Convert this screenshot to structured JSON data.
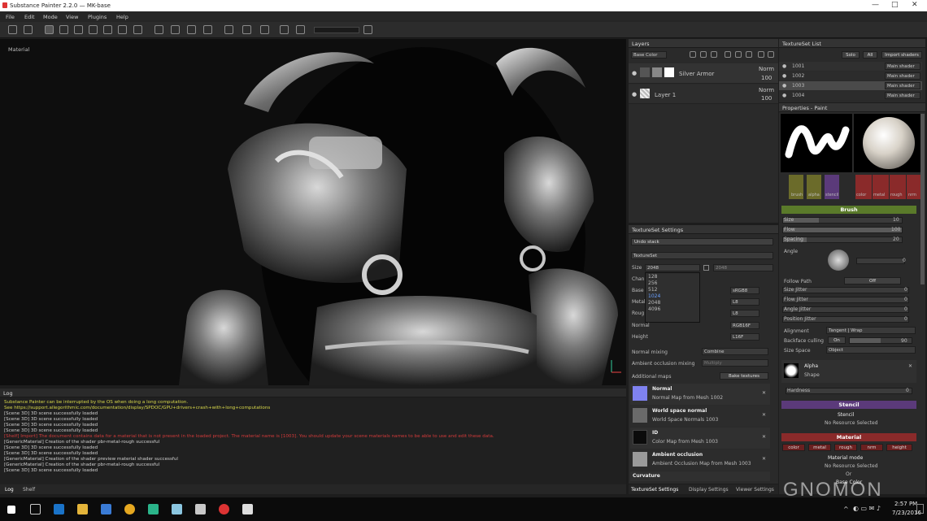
{
  "window": {
    "title": "Substance Painter 2.2.0 — MK-base",
    "controls": [
      "—",
      "□",
      "✕"
    ]
  },
  "menu": [
    "File",
    "Edit",
    "Mode",
    "View",
    "Plugins",
    "Help"
  ],
  "viewport": {
    "label": "Material"
  },
  "layers": {
    "title": "Layers",
    "channel": "Base Color",
    "items": [
      {
        "name": "Silver Armor",
        "blend": "Norm",
        "opacity": "100"
      },
      {
        "name": "Layer 1",
        "blend": "Norm",
        "opacity": "100"
      }
    ]
  },
  "textureset_list": {
    "title": "TextureSet List",
    "buttons": {
      "solo": "Solo",
      "all": "All",
      "import": "Import shaders"
    },
    "items": [
      {
        "name": "1001",
        "shader": "Main shader"
      },
      {
        "name": "1002",
        "shader": "Main shader"
      },
      {
        "name": "1003",
        "shader": "Main shader"
      },
      {
        "name": "1004",
        "shader": "Main shader"
      }
    ]
  },
  "properties": {
    "title": "Properties - Paint",
    "thumbs": [
      "brush",
      "alpha",
      "stencil"
    ],
    "mat_thumbs": [
      "color",
      "metal",
      "rough",
      "nrm"
    ],
    "brush_section": "Brush",
    "size": {
      "label": "Size",
      "value": "10"
    },
    "flow": {
      "label": "Flow",
      "value": "100"
    },
    "spacing": {
      "label": "Spacing",
      "value": "20"
    },
    "angle": {
      "label": "Angle",
      "value": "0"
    },
    "follow_path": {
      "label": "Follow Path",
      "value": "Off"
    },
    "jitters": [
      {
        "label": "Size Jitter",
        "value": "0"
      },
      {
        "label": "Flow Jitter",
        "value": "0"
      },
      {
        "label": "Angle Jitter",
        "value": "0"
      },
      {
        "label": "Position Jitter",
        "value": "0"
      }
    ],
    "alignment": {
      "label": "Alignment",
      "value": "Tangent | Wrap"
    },
    "backface": {
      "label": "Backface culling",
      "toggle": "On",
      "value": "90"
    },
    "size_space": {
      "label": "Size Space",
      "value": "Object"
    },
    "alpha": {
      "label": "Alpha",
      "value": "Shape"
    },
    "hardness": {
      "label": "Hardness",
      "value": "0"
    },
    "stencil_section": "Stencil",
    "stencil": {
      "label": "Stencil",
      "value": "No Resource Selected"
    },
    "material_section": "Material",
    "material_channels": [
      "color",
      "metal",
      "rough",
      "nrm",
      "height"
    ],
    "material_mode": {
      "label": "Material mode",
      "value": "No Resource Selected",
      "or": "Or"
    },
    "base_color": "Base Color"
  },
  "textureset_settings": {
    "title": "TextureSet Settings",
    "undo": "Undo stack",
    "texset": "TextureSet",
    "size": {
      "label": "Size",
      "value": "2048",
      "value2": "2048"
    },
    "size_options": [
      "128",
      "256",
      "512",
      "1024",
      "2048",
      "4096"
    ],
    "rows": [
      {
        "label": "Chan",
        "value": ""
      },
      {
        "label": "Base",
        "value": "sRGB8"
      },
      {
        "label": "Metal",
        "value": "L8"
      },
      {
        "label": "Roug",
        "value": "L8"
      },
      {
        "label": "Normal",
        "value": "RGB16F"
      },
      {
        "label": "Height",
        "value": "L16F"
      }
    ],
    "normal_mixing": {
      "label": "Normal mixing",
      "value": "Combine"
    },
    "ao_mixing": {
      "label": "Ambient occlusion mixing",
      "value": "Multiply"
    },
    "additional_maps": "Additional maps",
    "bake_button": "Bake textures",
    "maps": [
      {
        "name": "Normal",
        "desc": "Normal Map from Mesh 1002",
        "color": "#7f82f0"
      },
      {
        "name": "World space normal",
        "desc": "World Space Normals 1003",
        "color": "#6a6a6a"
      },
      {
        "name": "ID",
        "desc": "Color Map from Mesh 1003",
        "color": "#0b0b0b"
      },
      {
        "name": "Ambient occlusion",
        "desc": "Ambient Occlusion Map from Mesh 1003",
        "color": "#9a9a9a"
      },
      {
        "name": "Curvature",
        "desc": "",
        "color": "#777"
      }
    ],
    "tabs": [
      "TextureSet Settings",
      "Display Settings",
      "Viewer Settings"
    ]
  },
  "log": {
    "title": "Log",
    "lines": [
      {
        "text": "Substance Painter can be interrupted by the OS when doing a long computation.",
        "color": "#d8d84a"
      },
      {
        "text": "  See https://support.allegorithmic.com/documentation/display/SPDOC/GPU+drivers+crash+with+long+computations",
        "color": "#d8d84a"
      },
      {
        "text": "[Scene 3D] 3D scene successfully loaded",
        "color": "#d0d0d0"
      },
      {
        "text": "[Scene 3D] 3D scene successfully loaded",
        "color": "#d0d0d0"
      },
      {
        "text": "[Scene 3D] 3D scene successfully loaded",
        "color": "#d0d0d0"
      },
      {
        "text": "[Scene 3D] 3D scene successfully loaded",
        "color": "#d0d0d0"
      },
      {
        "text": "[Shelf] Import] The document contains data for a material that is not present in the loaded project. The material name is [1003]. You should update your scene materials names to be able to use and edit these data.",
        "color": "#d23a3a"
      },
      {
        "text": "[GenericMaterial] Creation of the shader pbr-metal-rough successful",
        "color": "#d0d0d0"
      },
      {
        "text": "[Scene 3D] 3D scene successfully loaded",
        "color": "#d0d0d0"
      },
      {
        "text": "[Scene 3D] 3D scene successfully loaded",
        "color": "#d0d0d0"
      },
      {
        "text": "[GenericMaterial] Creation of the shader preview material shader successful",
        "color": "#d0d0d0"
      },
      {
        "text": "[GenericMaterial] Creation of the shader pbr-metal-rough successful",
        "color": "#d0d0d0"
      },
      {
        "text": "[Scene 3D] 3D scene successfully loaded",
        "color": "#d0d0d0"
      }
    ],
    "tabs": [
      "Log",
      "Shelf"
    ]
  },
  "watermark": "GNOMON",
  "taskbar": {
    "time": "2:57 PM",
    "date": "7/23/2016"
  },
  "colors": {
    "brush": "#5a7a2a",
    "stencil": "#5b3a7a",
    "material": "#8a2a2a",
    "accent": "#c9a227"
  }
}
